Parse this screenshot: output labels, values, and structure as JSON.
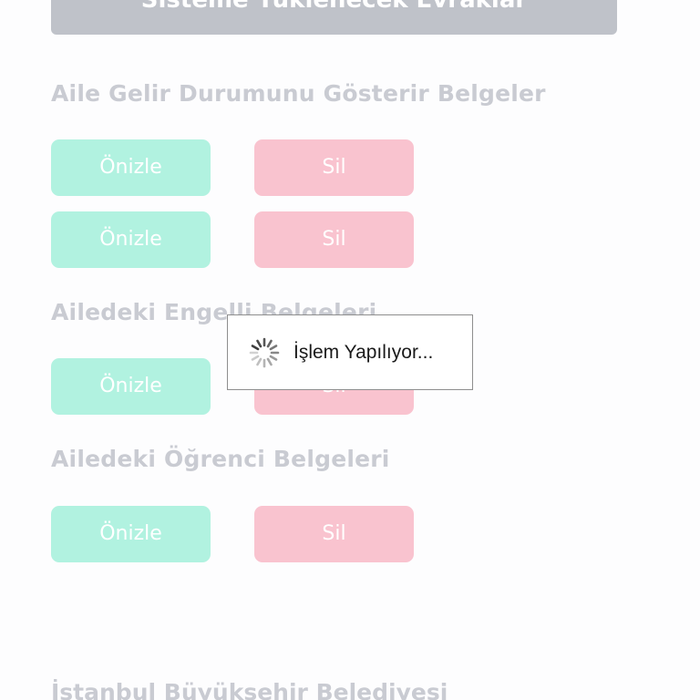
{
  "header": {
    "title": "Sisteme Yüklenecek Evraklar"
  },
  "sections": [
    {
      "heading": "Aile Gelir Durumunu Gösterir Belgeler",
      "rows": [
        {
          "preview_label": "Önizle",
          "delete_label": "Sil"
        },
        {
          "preview_label": "Önizle",
          "delete_label": "Sil"
        }
      ]
    },
    {
      "heading": "Ailedeki Engelli Belgeleri",
      "rows": [
        {
          "preview_label": "Önizle",
          "delete_label": "Sil"
        }
      ]
    },
    {
      "heading": "Ailedeki Öğrenci Belgeleri",
      "rows": [
        {
          "preview_label": "Önizle",
          "delete_label": "Sil"
        }
      ]
    }
  ],
  "footer": {
    "text": "İstanbul Büyükşehir Belediyesi"
  },
  "loading_dialog": {
    "message": "İşlem Yapılıyor...",
    "icon": "spinner-icon"
  },
  "colors": {
    "preview_button": "#b1f2e0",
    "delete_button": "#f9c3cf",
    "heading_text": "#c9cbd2",
    "header_banner": "#bfc2c9"
  }
}
